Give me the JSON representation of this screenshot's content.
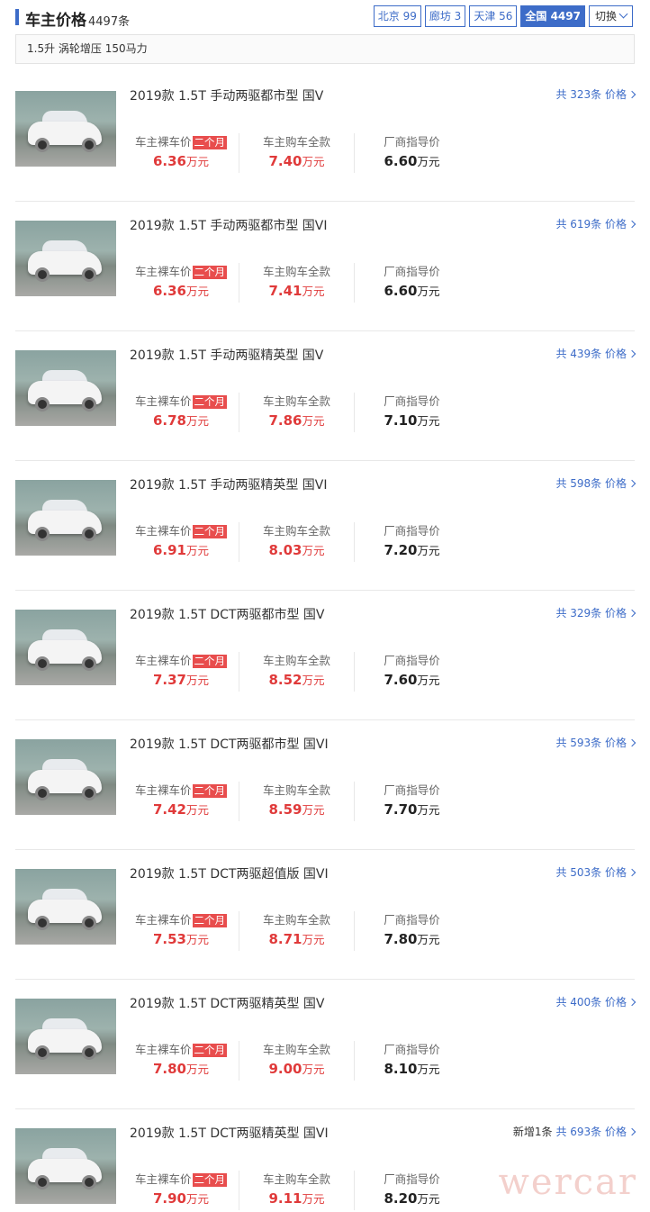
{
  "header": {
    "title": "车主价格",
    "count": "4497条"
  },
  "regions": [
    {
      "label": "北京 99",
      "active": false
    },
    {
      "label": "廊坊 3",
      "active": false
    },
    {
      "label": "天津 56",
      "active": false
    },
    {
      "label": "全国 4497",
      "active": true
    }
  ],
  "switch_label": "切换",
  "spec": "1.5升 涡轮增压 150马力",
  "labels": {
    "naked": "车主裸车价",
    "badge": "二个月",
    "full": "车主购车全款",
    "guide": "厂商指导价",
    "unit": "万元"
  },
  "items": [
    {
      "model": "2019款 1.5T 手动两驱都市型 国V",
      "more": "共 323条 价格",
      "new": "",
      "naked": "6.36",
      "full": "7.40",
      "guide": "6.60"
    },
    {
      "model": "2019款 1.5T 手动两驱都市型 国VI",
      "more": "共 619条 价格",
      "new": "",
      "naked": "6.36",
      "full": "7.41",
      "guide": "6.60"
    },
    {
      "model": "2019款 1.5T 手动两驱精英型 国V",
      "more": "共 439条 价格",
      "new": "",
      "naked": "6.78",
      "full": "7.86",
      "guide": "7.10"
    },
    {
      "model": "2019款 1.5T 手动两驱精英型 国VI",
      "more": "共 598条 价格",
      "new": "",
      "naked": "6.91",
      "full": "8.03",
      "guide": "7.20"
    },
    {
      "model": "2019款 1.5T DCT两驱都市型 国V",
      "more": "共 329条 价格",
      "new": "",
      "naked": "7.37",
      "full": "8.52",
      "guide": "7.60"
    },
    {
      "model": "2019款 1.5T DCT两驱都市型 国VI",
      "more": "共 593条 价格",
      "new": "",
      "naked": "7.42",
      "full": "8.59",
      "guide": "7.70"
    },
    {
      "model": "2019款 1.5T DCT两驱超值版 国VI",
      "more": "共 503条 价格",
      "new": "",
      "naked": "7.53",
      "full": "8.71",
      "guide": "7.80"
    },
    {
      "model": "2019款 1.5T DCT两驱精英型 国V",
      "more": "共 400条 价格",
      "new": "",
      "naked": "7.80",
      "full": "9.00",
      "guide": "8.10"
    },
    {
      "model": "2019款 1.5T DCT两驱精英型 国VI",
      "more": "共 693条 价格",
      "new": "新增1条",
      "naked": "7.90",
      "full": "9.11",
      "guide": "8.20"
    }
  ],
  "watermark": "wercar"
}
